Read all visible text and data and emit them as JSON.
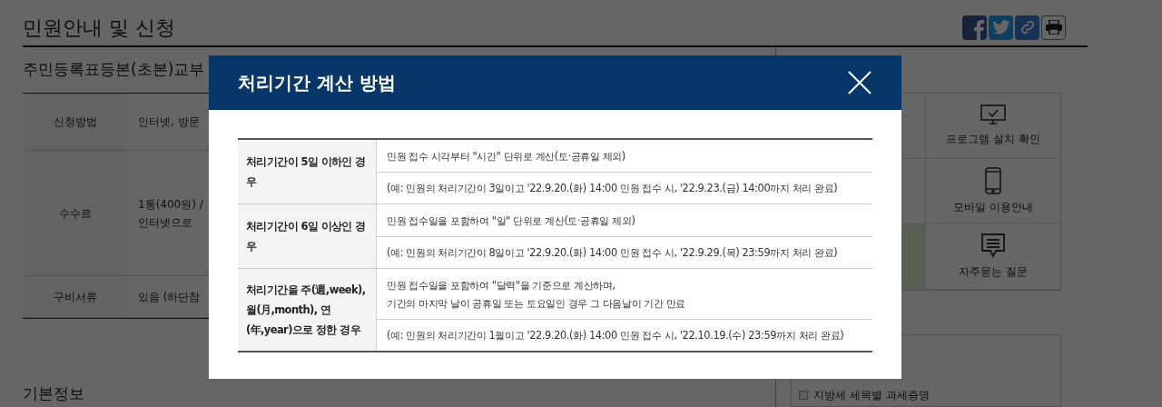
{
  "page_title": "민원안내 및 신청",
  "share_buttons": [
    {
      "kind": "facebook"
    },
    {
      "kind": "twitter"
    },
    {
      "kind": "link"
    },
    {
      "kind": "print"
    }
  ],
  "service_title": "주민등록표등본(초본)교부",
  "info_rows": [
    {
      "label": "신청방법",
      "lines": [
        "인터넷, 방문"
      ]
    },
    {
      "label": "수수료",
      "lines": [
        "1통(400원) /",
        "인터넷으로"
      ]
    },
    {
      "label": "구비서류",
      "lines": [
        "있음 (하단참"
      ]
    }
  ],
  "quick_menu": [
    {
      "kind": "monitor",
      "label": "프로그램 설치 확인"
    },
    {
      "kind": "phone",
      "label": "모바일 이용안내"
    },
    {
      "kind": "chat",
      "label": "자주묻는 질문"
    }
  ],
  "related_items": [
    {
      "label": "지방세 세목별 과세증명",
      "checked": false
    }
  ],
  "section_heading": "기본정보",
  "modal": {
    "title": "처리기간 계산 방법",
    "rows": [
      {
        "case": "처리기간이 5일 이하인 경우",
        "entries": [
          {
            "lines": [
              "민원 접수 시각부터 \"시간\" 단위로 계산(토·공휴일 제외)"
            ]
          },
          {
            "lines": [
              "(예: 민원의 처리기간이 3일이고 '22.9.20.(화) 14:00 민원 접수 시, '22.9.23.(금) 14:00까지 처리 완료)"
            ]
          }
        ]
      },
      {
        "case": "처리기간이 6일 이상인 경우",
        "entries": [
          {
            "lines": [
              "민원 접수일을 포함하여 \"일\" 단위로 계산(토·공휴일 제외)"
            ]
          },
          {
            "lines": [
              "(예: 민원의 처리기간이 8일이고 '22.9.20.(화) 14:00 민원 접수 시, '22.9.29.(목) 23:59까지 처리 완료)"
            ]
          }
        ]
      },
      {
        "case": "처리기간을 주(週,week), 월(月,month), 연(年,year)으로 정한 경우",
        "entries": [
          {
            "lines": [
              "민원 접수일을 포함하여 \"달력\"을 기준으로 계산하며,",
              "기간의 마지막 날이 공휴일 또는 토요일인 경우 그 다음날이 기간 만료"
            ]
          },
          {
            "lines": [
              "(예: 민원의 처리기간이 1월이고 '22.9.20.(화) 14:00 민원 접수 시, '22.10.19.(수) 23:59까지 처리 완료)"
            ]
          }
        ]
      }
    ]
  }
}
